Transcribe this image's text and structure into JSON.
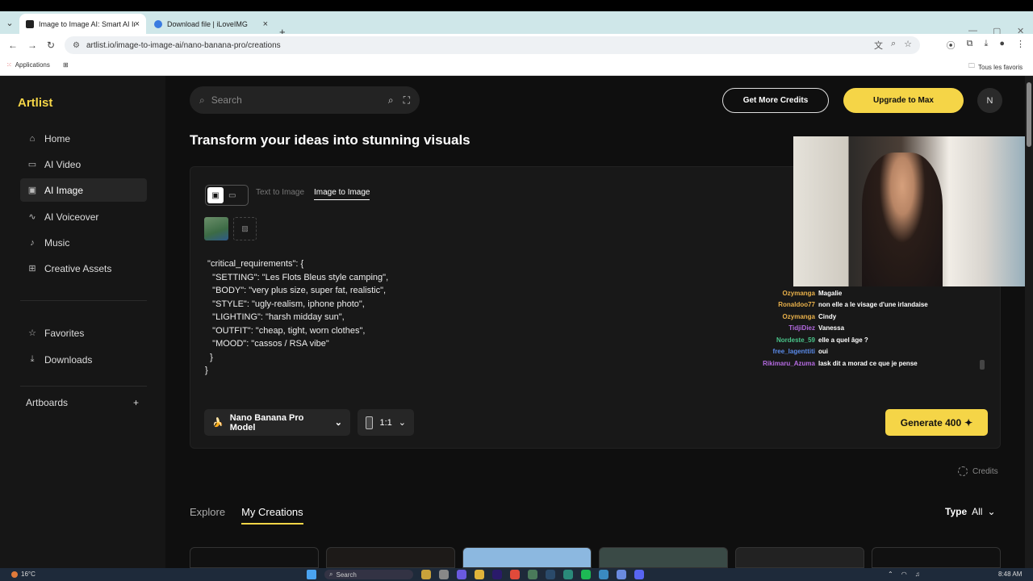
{
  "browser": {
    "tabs": [
      {
        "title": "Image to Image AI: Smart AI Im",
        "active": true
      },
      {
        "title": "Download file | iLoveIMG",
        "active": false
      }
    ],
    "url": "artlist.io/image-to-image-ai/nano-banana-pro/creations",
    "bookmarks": {
      "apps": "Applications",
      "all": "Tous les favoris"
    }
  },
  "sidebar": {
    "logo": "Artlist",
    "items": [
      {
        "label": "Home",
        "icon": "home-icon"
      },
      {
        "label": "AI Video",
        "icon": "video-icon"
      },
      {
        "label": "AI Image",
        "icon": "image-icon",
        "active": true
      },
      {
        "label": "AI Voiceover",
        "icon": "waveform-icon"
      },
      {
        "label": "Music",
        "icon": "music-note-icon"
      },
      {
        "label": "Creative Assets",
        "icon": "grid-icon"
      }
    ],
    "secondary": [
      {
        "label": "Favorites",
        "icon": "star-icon"
      },
      {
        "label": "Downloads",
        "icon": "download-icon"
      }
    ],
    "artboards": "Artboards"
  },
  "header": {
    "search_placeholder": "Search",
    "get_credits": "Get More Credits",
    "upgrade": "Upgrade to Max",
    "avatar_initial": "N"
  },
  "main": {
    "headline": "Transform your ideas into stunning visuals",
    "tabs": {
      "text_to_image": "Text to Image",
      "image_to_image": "Image to Image"
    },
    "prompt": " \"critical_requirements\": {\n   \"SETTING\": \"Les Flots Bleus style camping\",\n   \"BODY\": \"very plus size, super fat, realistic\",\n   \"STYLE\": \"ugly-realism, iphone photo\",\n   \"LIGHTING\": \"harsh midday sun\",\n   \"OUTFIT\": \"cheap, tight, worn clothes\",\n   \"MOOD\": \"cassos / RSA vibe\"\n  }\n}",
    "model": "Nano Banana Pro Model",
    "ratio": "1:1",
    "generate": "Generate 400",
    "credits_label": "Credits",
    "bottom_tabs": {
      "explore": "Explore",
      "mine": "My Creations"
    },
    "type_filter": {
      "label": "Type",
      "value": "All"
    }
  },
  "chat": [
    {
      "user": "Ozymanga",
      "color": "#e8b04a",
      "msg": "Magalie"
    },
    {
      "user": "Ronaldoo77",
      "color": "#e8b04a",
      "msg": "non elle a le visage d'une irlandaise"
    },
    {
      "user": "Ozymanga",
      "color": "#e8b04a",
      "msg": "Cindy"
    },
    {
      "user": "TidjiDiez",
      "color": "#b46ae0",
      "msg": "Vanessa"
    },
    {
      "user": "Nordeste_59",
      "color": "#4ac48a",
      "msg": "elle a quel âge ?"
    },
    {
      "user": "free_lagenttiti",
      "color": "#5a8ae8",
      "msg": "oui"
    },
    {
      "user": "Rikimaru_Azuma",
      "color": "#b46ae0",
      "msg": "lask dit a morad ce que je pense"
    }
  ],
  "taskbar": {
    "temp": "16°C",
    "search": "Search",
    "time": "8:48 AM"
  }
}
